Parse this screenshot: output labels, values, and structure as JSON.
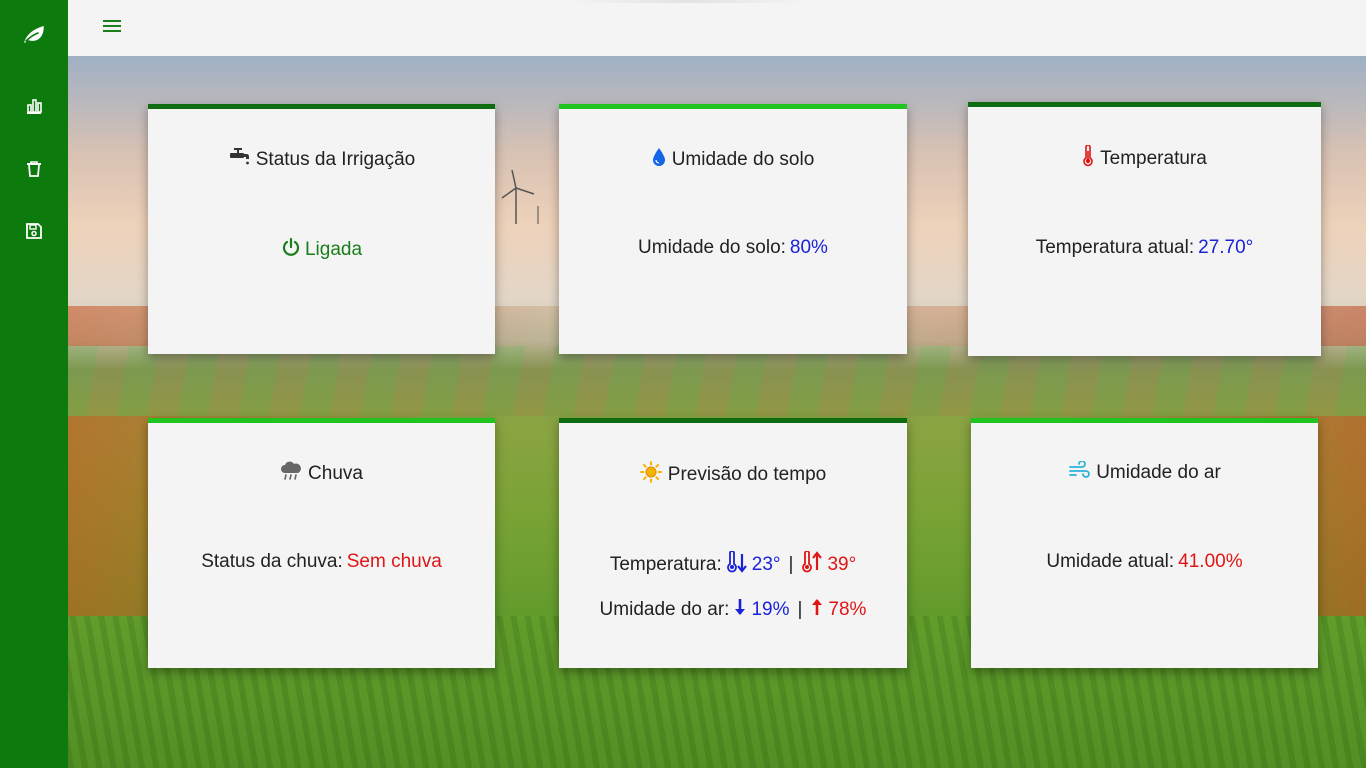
{
  "sidebar": {
    "items": [
      {
        "icon": "leaf-icon"
      },
      {
        "icon": "bar-chart-icon"
      },
      {
        "icon": "trash-icon"
      },
      {
        "icon": "save-icon"
      }
    ]
  },
  "topbar": {
    "menu_icon": "hamburger-menu-icon"
  },
  "cards": {
    "irrigation": {
      "title": "Status da Irrigação",
      "status": "Ligada",
      "accent": "#0f6b0f"
    },
    "soil": {
      "title": "Umidade do solo",
      "label": "Umidade do solo:",
      "value": "80%",
      "accent": "#1fc41f"
    },
    "temperature": {
      "title": "Temperatura",
      "label": "Temperatura atual:",
      "value": "27.70°",
      "accent": "#0f6b0f"
    },
    "rain": {
      "title": "Chuva",
      "label": "Status da chuva:",
      "value": "Sem chuva",
      "accent": "#1fc41f"
    },
    "forecast": {
      "title": "Previsão do tempo",
      "temp_label": "Temperatura:",
      "temp_min": "23°",
      "temp_max": "39°",
      "humidity_label": "Umidade do ar:",
      "humidity_min": "19%",
      "humidity_max": "78%",
      "separator": "|",
      "accent": "#0f6b0f"
    },
    "air": {
      "title": "Umidade do ar",
      "label": "Umidade atual:",
      "value": "41.00%",
      "accent": "#1fc41f"
    }
  },
  "colors": {
    "sidebar": "#0d7a0d",
    "value_blue": "#1a22d6",
    "value_red": "#e01515",
    "status_green": "#1b7d1b"
  }
}
